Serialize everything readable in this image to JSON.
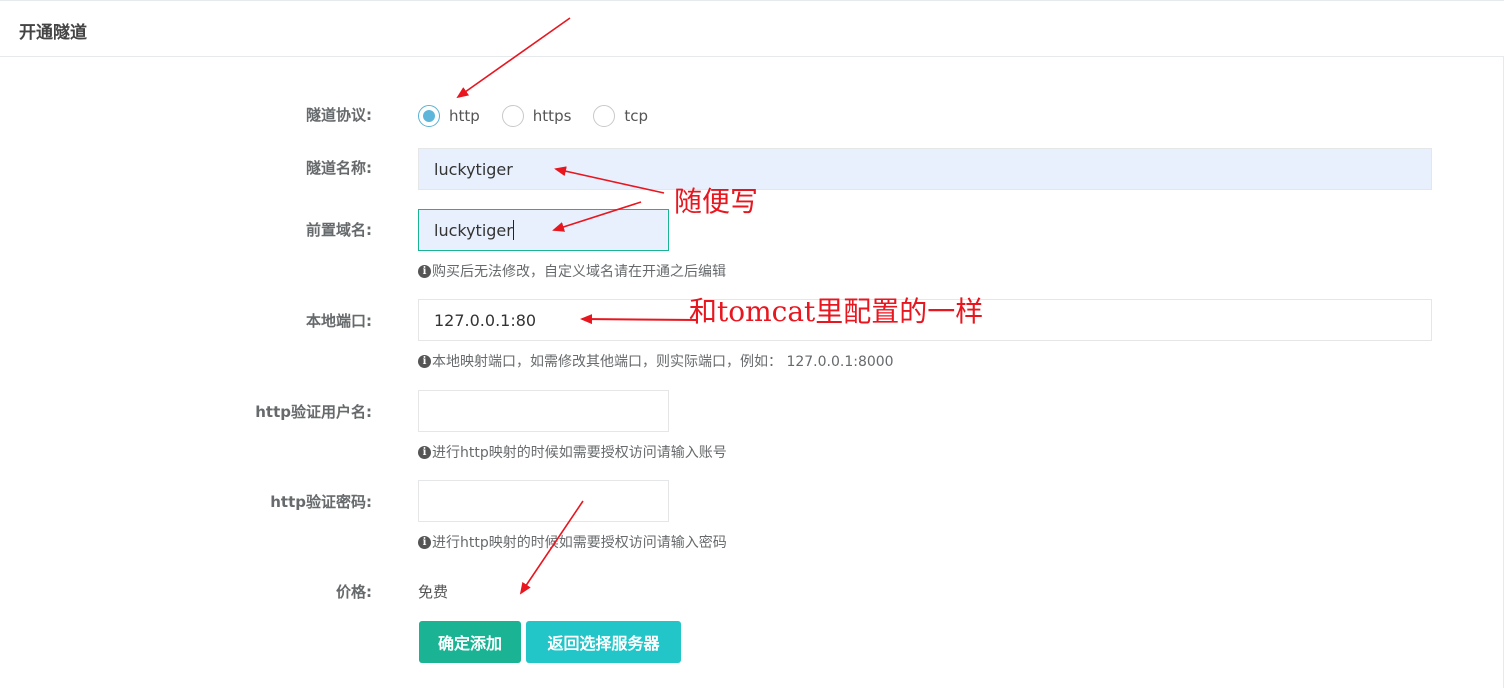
{
  "panel": {
    "title": "开通隧道"
  },
  "form": {
    "protocol": {
      "label": "隧道协议:",
      "options": [
        {
          "label": "http",
          "checked": true
        },
        {
          "label": "https",
          "checked": false
        },
        {
          "label": "tcp",
          "checked": false
        }
      ]
    },
    "tunnel_name": {
      "label": "隧道名称:",
      "value": "luckytiger"
    },
    "domain_prefix": {
      "label": "前置域名:",
      "value": "luckytiger",
      "help": "购买后无法修改，自定义域名请在开通之后编辑"
    },
    "local_port": {
      "label": "本地端口:",
      "value": "127.0.0.1:80",
      "help": "本地映射端口，如需修改其他端口，则实际端口，例如： 127.0.0.1:8000"
    },
    "http_user": {
      "label": "http验证用户名:",
      "value": "",
      "help": "进行http映射的时候如需要授权访问请输入账号"
    },
    "http_password": {
      "label": "http验证密码:",
      "value": "",
      "help": "进行http映射的时候如需要授权访问请输入密码"
    },
    "price": {
      "label": "价格:",
      "value": "免费"
    },
    "buttons": {
      "confirm": "确定添加",
      "back": "返回选择服务器"
    }
  },
  "annotations": {
    "note_any": "随便写",
    "note_tomcat": "和tomcat里配置的一样",
    "color": "#e8161f"
  },
  "theme": {
    "primary": "#1ab394",
    "info": "#23c6c8",
    "radio_checked": "#5fb6db",
    "autofill": "#e8f0fe"
  }
}
